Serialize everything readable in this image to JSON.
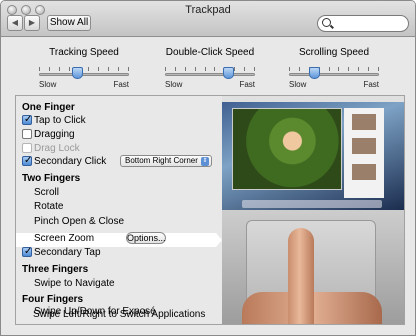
{
  "window": {
    "title": "Trackpad"
  },
  "toolbar": {
    "back_glyph": "◀",
    "forward_glyph": "▶",
    "show_all_label": "Show All",
    "search_placeholder": "",
    "search_value": ""
  },
  "sliders": [
    {
      "label": "Tracking Speed",
      "min_label": "Slow",
      "max_label": "Fast",
      "value_fraction": 0.42
    },
    {
      "label": "Double-Click Speed",
      "min_label": "Slow",
      "max_label": "Fast",
      "value_fraction": 0.73
    },
    {
      "label": "Scrolling Speed",
      "min_label": "Slow",
      "max_label": "Fast",
      "value_fraction": 0.25
    }
  ],
  "gestures": {
    "one_finger": {
      "heading": "One Finger",
      "tap_to_click": {
        "label": "Tap to Click",
        "checked": true
      },
      "dragging": {
        "label": "Dragging",
        "checked": false
      },
      "drag_lock": {
        "label": "Drag Lock",
        "checked": false,
        "enabled": false
      },
      "secondary_click": {
        "label": "Secondary Click",
        "checked": true,
        "selected_option": "Bottom Right Corner"
      }
    },
    "two_fingers": {
      "heading": "Two Fingers",
      "scroll": "Scroll",
      "rotate": "Rotate",
      "pinch": "Pinch Open & Close",
      "screen_zoom": "Screen Zoom",
      "options_button": "Options...",
      "secondary_tap": {
        "label": "Secondary Tap",
        "checked": true
      }
    },
    "three_fingers": {
      "heading": "Three Fingers",
      "swipe": "Swipe to Navigate"
    },
    "four_fingers": {
      "heading": "Four Fingers",
      "expose": "Swipe Up/Down for Exposé",
      "switch_apps": "Swipe Left/Right to Switch Applications"
    }
  },
  "icons": {
    "search": "magnifier-icon",
    "checkbox": "checkmark",
    "popup": "up-down-arrows"
  }
}
